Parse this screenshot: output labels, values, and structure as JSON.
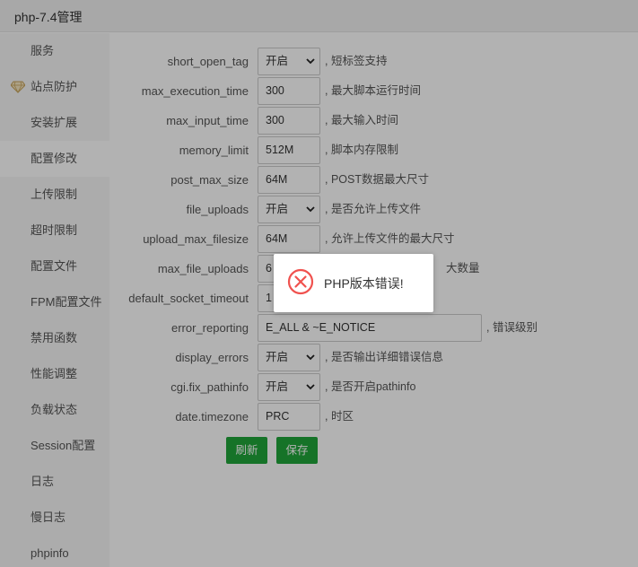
{
  "window": {
    "title": "php-7.4管理"
  },
  "sidebar": {
    "items": [
      {
        "label": "服务"
      },
      {
        "label": "站点防护"
      },
      {
        "label": "安装扩展"
      },
      {
        "label": "配置修改",
        "active": true
      },
      {
        "label": "上传限制"
      },
      {
        "label": "超时限制"
      },
      {
        "label": "配置文件"
      },
      {
        "label": "FPM配置文件"
      },
      {
        "label": "禁用函数"
      },
      {
        "label": "性能调整"
      },
      {
        "label": "负载状态"
      },
      {
        "label": "Session配置"
      },
      {
        "label": "日志"
      },
      {
        "label": "慢日志"
      },
      {
        "label": "phpinfo"
      }
    ],
    "icons": {
      "guard": "gem-icon"
    }
  },
  "config": {
    "rows": [
      {
        "name": "short_open_tag",
        "value": "开启",
        "type": "select",
        "desc": ", 短标签支持"
      },
      {
        "name": "max_execution_time",
        "value": "300",
        "type": "input",
        "desc": ", 最大脚本运行时间"
      },
      {
        "name": "max_input_time",
        "value": "300",
        "type": "input",
        "desc": ", 最大输入时间"
      },
      {
        "name": "memory_limit",
        "value": "512M",
        "type": "input",
        "desc": ", 脚本内存限制"
      },
      {
        "name": "post_max_size",
        "value": "64M",
        "type": "input",
        "desc": ", POST数据最大尺寸"
      },
      {
        "name": "file_uploads",
        "value": "开启",
        "type": "select",
        "desc": ", 是否允许上传文件"
      },
      {
        "name": "upload_max_filesize",
        "value": "64M",
        "type": "input",
        "desc": ", 允许上传文件的最大尺寸"
      },
      {
        "name": "max_file_uploads",
        "value": "6",
        "type": "input",
        "desc": "大数量"
      },
      {
        "name": "default_socket_timeout",
        "value": "1",
        "type": "input",
        "desc": ""
      },
      {
        "name": "error_reporting",
        "value": "E_ALL & ~E_NOTICE",
        "type": "input-wide",
        "desc": ", 错误级别"
      },
      {
        "name": "display_errors",
        "value": "开启",
        "type": "select",
        "desc": ", 是否输出详细错误信息"
      },
      {
        "name": "cgi.fix_pathinfo",
        "value": "开启",
        "type": "select",
        "desc": ", 是否开启pathinfo"
      },
      {
        "name": "date.timezone",
        "value": "PRC",
        "type": "input",
        "desc": ", 时区"
      }
    ]
  },
  "actions": {
    "refresh": "刷新",
    "save": "保存"
  },
  "toast": {
    "message": "PHP版本错误!",
    "icon": "error-circle-icon"
  },
  "colors": {
    "primary": "#20a53a",
    "error": "#f0524f",
    "overlay": "rgba(0,0,0,0.3)"
  }
}
